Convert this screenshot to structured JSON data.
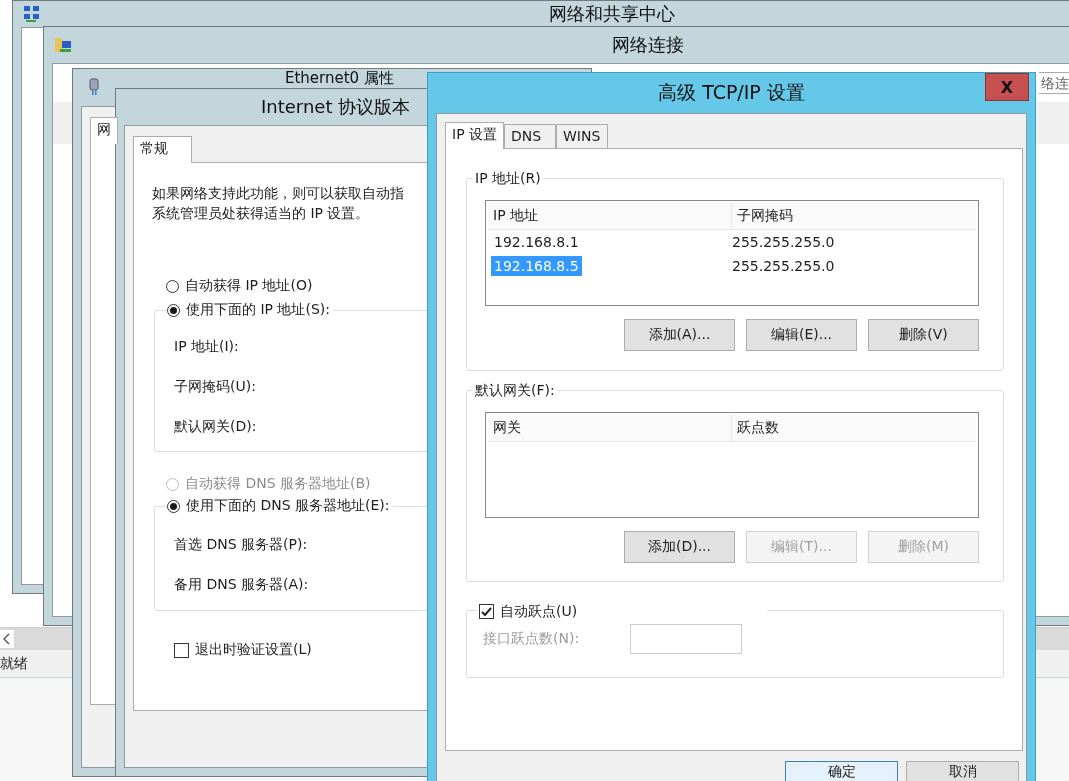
{
  "background_app": {
    "status_bar": "就绪"
  },
  "network_sharing_center": {
    "title": "网络和共享中心"
  },
  "network_connections": {
    "title": "网络连接",
    "search_text": "络连"
  },
  "ethernet_properties": {
    "title": "Ethernet0 属性",
    "tabs": [
      {
        "label": "网",
        "selected": true
      }
    ]
  },
  "ipv4_properties": {
    "title": "Internet 协议版本",
    "tabs": [
      {
        "label": "常规",
        "selected": true
      }
    ],
    "description": [
      "如果网络支持此功能，则可以获取自动指",
      "系统管理员处获得适当的 IP 设置。"
    ],
    "ip_options": [
      {
        "label": "自动获得 IP 地址(O)",
        "selected": false,
        "disabled": false
      },
      {
        "label": "使用下面的 IP 地址(S):",
        "selected": true,
        "disabled": false
      }
    ],
    "ip_fields": [
      "IP 地址(I):",
      "子网掩码(U):",
      "默认网关(D):"
    ],
    "dns_options": [
      {
        "label": "自动获得 DNS 服务器地址(B)",
        "selected": false,
        "disabled": true
      },
      {
        "label": "使用下面的 DNS 服务器地址(E):",
        "selected": true,
        "disabled": false
      }
    ],
    "dns_fields": [
      "首选 DNS 服务器(P):",
      "备用 DNS 服务器(A):"
    ],
    "validate_on_exit": {
      "label": "退出时验证设置(L)",
      "checked": false
    }
  },
  "advanced_tcpip": {
    "title": "高级 TCP/IP 设置",
    "close": "X",
    "tabs": [
      {
        "label": "IP 设置",
        "selected": true
      },
      {
        "label": "DNS",
        "selected": false
      },
      {
        "label": "WINS",
        "selected": false
      }
    ],
    "ip_addresses": {
      "label": "IP 地址(R)",
      "columns": [
        "IP 地址",
        "子网掩码"
      ],
      "rows": [
        {
          "ip": "192.168.8.1",
          "mask": "255.255.255.0",
          "selected": false
        },
        {
          "ip": "192.168.8.5",
          "mask": "255.255.255.0",
          "selected": true
        }
      ],
      "buttons": [
        {
          "label": "添加(A)...",
          "disabled": false
        },
        {
          "label": "编辑(E)...",
          "disabled": false
        },
        {
          "label": "删除(V)",
          "disabled": false
        }
      ]
    },
    "gateways": {
      "label": "默认网关(F):",
      "columns": [
        "网关",
        "跃点数"
      ],
      "buttons": [
        {
          "label": "添加(D)...",
          "disabled": false
        },
        {
          "label": "编辑(T)...",
          "disabled": true
        },
        {
          "label": "删除(M)",
          "disabled": true
        }
      ]
    },
    "automatic_metric": {
      "label": "自动跃点(U)",
      "checked": true,
      "interface_metric_label": "接口跃点数(N):"
    },
    "dialog_buttons": [
      {
        "label": "确定",
        "default": true
      },
      {
        "label": "取消",
        "default": false
      }
    ]
  }
}
